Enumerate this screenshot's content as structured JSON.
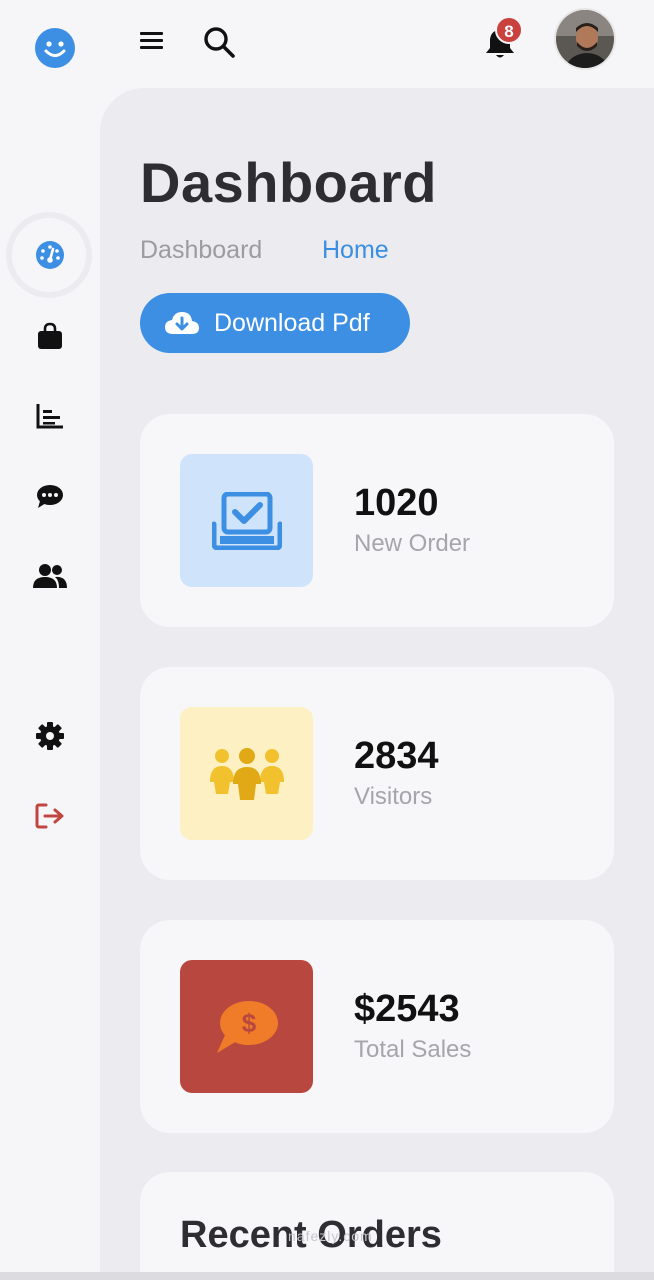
{
  "header": {
    "notification_count": "8"
  },
  "sidebar": {
    "items": [
      {
        "name": "dashboard",
        "icon": "speedometer-icon",
        "active": true
      },
      {
        "name": "shop",
        "icon": "shopping-bag-icon"
      },
      {
        "name": "analytics",
        "icon": "bar-chart-icon"
      },
      {
        "name": "messages",
        "icon": "chat-bubble-icon"
      },
      {
        "name": "customers",
        "icon": "users-icon"
      },
      {
        "name": "settings",
        "icon": "gear-icon"
      },
      {
        "name": "logout",
        "icon": "logout-icon"
      }
    ]
  },
  "main": {
    "title": "Dashboard",
    "breadcrumb": [
      "Dashboard",
      "Home"
    ],
    "download_label": "Download Pdf",
    "cards": [
      {
        "value": "1020",
        "label": "New Order",
        "icon": "inbox-check-icon",
        "bg": "#cfe4fb",
        "fg": "#3c8fe3"
      },
      {
        "value": "2834",
        "label": "Visitors",
        "icon": "people-icon",
        "bg": "#fdf0c2",
        "fg": "#f2c12e"
      },
      {
        "value": "$2543",
        "label": "Total Sales",
        "icon": "dollar-chat-icon",
        "bg": "#b8483f",
        "fg": "#f07b28"
      }
    ],
    "recent_orders_title": "Recent Orders"
  },
  "watermark": "nafezly.com",
  "colors": {
    "accent": "#3c8fe3",
    "danger": "#c9423d",
    "background": "#ececf0"
  }
}
